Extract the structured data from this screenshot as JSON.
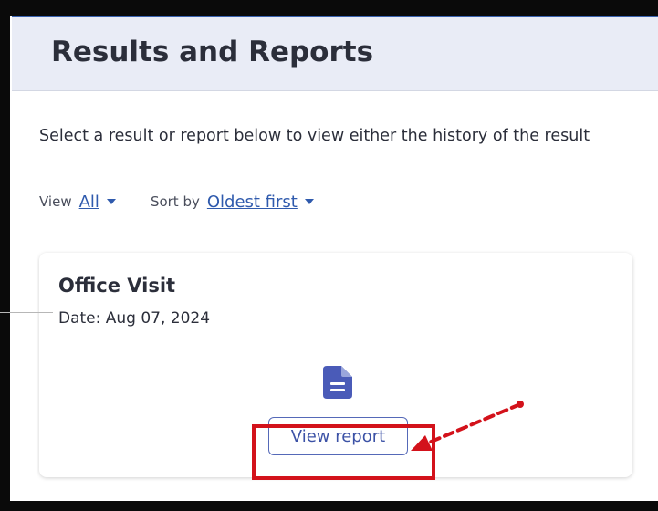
{
  "page": {
    "title": "Results and Reports",
    "intro": "Select a result or report below to view either the history of the result"
  },
  "filters": {
    "view_label": "View",
    "view_value": "All",
    "sort_label": "Sort by",
    "sort_value": "Oldest first"
  },
  "card": {
    "title": "Office Visit",
    "date": "Date: Aug 07, 2024",
    "icon": "document-icon",
    "button_label": "View report"
  },
  "annotation": {
    "color": "#d3121b"
  },
  "colors": {
    "header_bg": "#e9ecf6",
    "link": "#2f5aad",
    "button_text": "#3c52a6",
    "icon": "#4a5bb8"
  }
}
